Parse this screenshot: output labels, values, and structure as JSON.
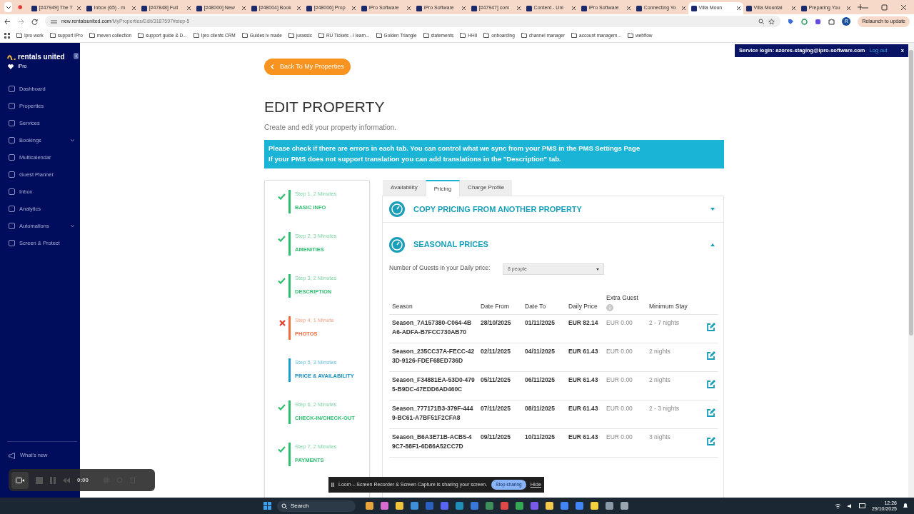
{
  "browser": {
    "tabs": [
      {
        "title": "[#47949] The T",
        "selected": false
      },
      {
        "title": "Inbox (65) - m",
        "selected": false
      },
      {
        "title": "[#47848] Full",
        "selected": false
      },
      {
        "title": "[#48000] New",
        "selected": false
      },
      {
        "title": "[#48004] Book",
        "selected": false
      },
      {
        "title": "[#48006] Prop",
        "selected": false
      },
      {
        "title": "iPro Software",
        "selected": false
      },
      {
        "title": "iPro Software",
        "selected": false
      },
      {
        "title": "[#47947] com",
        "selected": false
      },
      {
        "title": "Content - Uni",
        "selected": false
      },
      {
        "title": "iPro Software",
        "selected": false
      },
      {
        "title": "Connecting Yo",
        "selected": false
      },
      {
        "title": "Villa Moun",
        "selected": true
      },
      {
        "title": "Villa Mountai",
        "selected": false
      },
      {
        "title": "Preparing You",
        "selected": false
      }
    ],
    "url_host": "new.rentalsunited.com",
    "url_path": "/MyProperties/Edit/3187597#step-5",
    "profile_initial": "R",
    "relaunch": "Relaunch to update",
    "bookmarks": [
      "Ipro work",
      "support iPro",
      "meven collection",
      "support guide & D...",
      "Ipro clients CRM",
      "Guides iv made",
      "jurassic",
      "RU Tickets - I learn...",
      "Golden Triangle",
      "statements",
      "HHII",
      "onboarding",
      "channel manager",
      "account managem...",
      "webflow"
    ]
  },
  "sidebar": {
    "brand": "rentals united",
    "account": "iPro",
    "items": [
      {
        "label": "Dashboard",
        "has_submenu": false
      },
      {
        "label": "Properties",
        "has_submenu": false
      },
      {
        "label": "Services",
        "has_submenu": false
      },
      {
        "label": "Bookings",
        "has_submenu": true
      },
      {
        "label": "Multicalendar",
        "has_submenu": false
      },
      {
        "label": "Guest Planner",
        "has_submenu": false
      },
      {
        "label": "Inbox",
        "has_submenu": false
      },
      {
        "label": "Analytics",
        "has_submenu": false
      },
      {
        "label": "Automations",
        "has_submenu": true
      },
      {
        "label": "Screen & Protect",
        "has_submenu": false
      }
    ],
    "footer_items": [
      "What's new"
    ]
  },
  "service_banner": {
    "text": "Service login: azores-staging@ipro-software.com",
    "action": "Log out",
    "close": "x"
  },
  "back_button": "Back To My Properties",
  "page_title": "EDIT PROPERTY",
  "subtitle": "Create and edit your property information.",
  "alert": [
    "Please check if there are errors in each tab. You can control what we sync from your PMS in the PMS Settings Page",
    "If your PMS does not support translation you can add translations in the \"Description\" tab."
  ],
  "steps": [
    {
      "caption": "Step 1, 2 Minutes",
      "label": "BASIC INFO",
      "kind": "done"
    },
    {
      "caption": "Step 2, 3 Minutes",
      "label": "AMENITIES",
      "kind": "done"
    },
    {
      "caption": "Step 3, 2 Minutes",
      "label": "DESCRIPTION",
      "kind": "done"
    },
    {
      "caption": "Step 4, 1 Minute",
      "label": "PHOTOS",
      "kind": "error"
    },
    {
      "caption": "Step 5, 3 Minutes",
      "label": "PRICE & AVAILABILITY",
      "kind": "active"
    },
    {
      "caption": "Step 6, 2 Minutes",
      "label": "CHECK-IN/CHECK-OUT",
      "kind": "done"
    },
    {
      "caption": "Step 7, 2 Minutes",
      "label": "PAYMENTS",
      "kind": "done"
    }
  ],
  "tabs": [
    {
      "label": "Availability",
      "selected": false
    },
    {
      "label": "Pricing",
      "selected": true
    },
    {
      "label": "Charge Profile",
      "selected": false
    }
  ],
  "sections": [
    {
      "title": "COPY PRICING FROM ANOTHER PROPERTY",
      "expanded": false
    },
    {
      "title": "SEASONAL PRICES",
      "expanded": true
    }
  ],
  "guests": {
    "label": "Number of Guests in your Daily price:",
    "value": "8 people"
  },
  "table": {
    "columns": [
      "Season",
      "Date From",
      "Date To",
      "Daily Price",
      "Extra Guest",
      "Minimum Stay"
    ],
    "rows": [
      {
        "season": "Season_7A157380-C064-4BA6-ADFA-B7FCC730AB70",
        "date_from": "28/10/2025",
        "date_to": "01/11/2025",
        "daily_price": "EUR 82.14",
        "extra_guest": "EUR 0.00",
        "minimum_stay": "2 - 7 nights"
      },
      {
        "season": "Season_235CC37A-FECC-423D-9126-FDEF68ED736D",
        "date_from": "02/11/2025",
        "date_to": "04/11/2025",
        "daily_price": "EUR 61.43",
        "extra_guest": "EUR 0.00",
        "minimum_stay": "2 nights"
      },
      {
        "season": "Season_F34881EA-53D0-4795-B9DC-47EDD6AD460C",
        "date_from": "05/11/2025",
        "date_to": "06/11/2025",
        "daily_price": "EUR 61.43",
        "extra_guest": "EUR 0.00",
        "minimum_stay": "2 nights"
      },
      {
        "season": "Season_777171B3-379F-4449-BC61-A7BF51F2CFA8",
        "date_from": "07/11/2025",
        "date_to": "08/11/2025",
        "daily_price": "EUR 61.43",
        "extra_guest": "EUR 0.00",
        "minimum_stay": "2 - 3 nights"
      },
      {
        "season": "Season_B6A3E71B-ACB5-49C7-88F1-6D86A52CC7D",
        "date_from": "09/11/2025",
        "date_to": "10/11/2025",
        "daily_price": "EUR 61.43",
        "extra_guest": "EUR 0.00",
        "minimum_stay": "3 nights"
      }
    ]
  },
  "recorder": {
    "time": "0:00"
  },
  "share_bar": {
    "text": "Loom – Screen Recorder & Screen Capture is sharing your screen.",
    "stop": "Stop sharing",
    "hide": "Hide"
  },
  "taskbar": {
    "search": "Search",
    "time": "12:26",
    "date": "29/10/2025"
  }
}
